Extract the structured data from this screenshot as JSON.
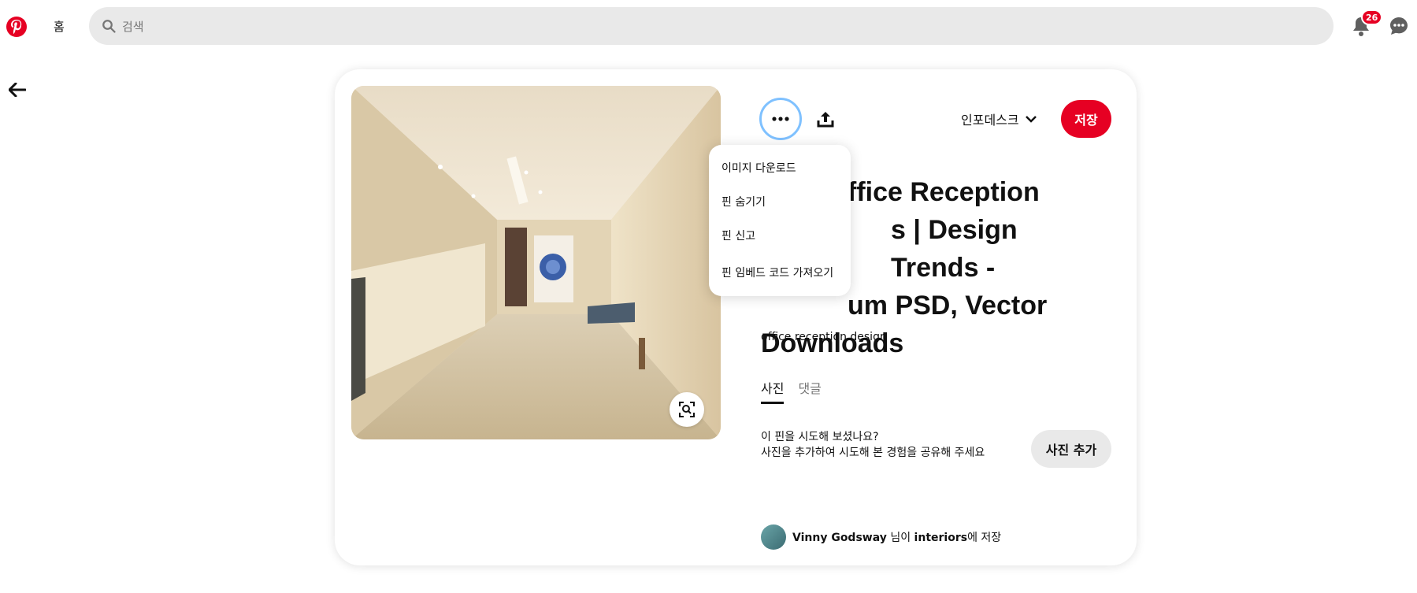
{
  "header": {
    "home_label": "홈",
    "search_placeholder": "검색",
    "notifications_count": "26"
  },
  "pin": {
    "board_name": "인포데스크",
    "save_label": "저장",
    "source_link": "m",
    "title": "ffice Reception\ns | Design Trends -\num PSD, Vector\nDownloads",
    "description": "office reception design",
    "tabs": [
      "사진",
      "댓글"
    ],
    "try_line1": "이 핀을 시도해 보셨나요?",
    "try_line2": "사진을 추가하여 시도해 본 경험을 공유해 주세요",
    "add_photo_label": "사진 추가",
    "saver_name": "Vinny Godsway",
    "saver_mid": " 님이 ",
    "saver_board": "interiors",
    "saver_suffix": "에 저장"
  },
  "menu": {
    "items": [
      "이미지 다운로드",
      "핀 숨기기",
      "핀 신고",
      "핀 임베드 코드 가져오기"
    ]
  },
  "colors": {
    "brand": "#e60023",
    "focus_ring": "#7fc1ff"
  }
}
